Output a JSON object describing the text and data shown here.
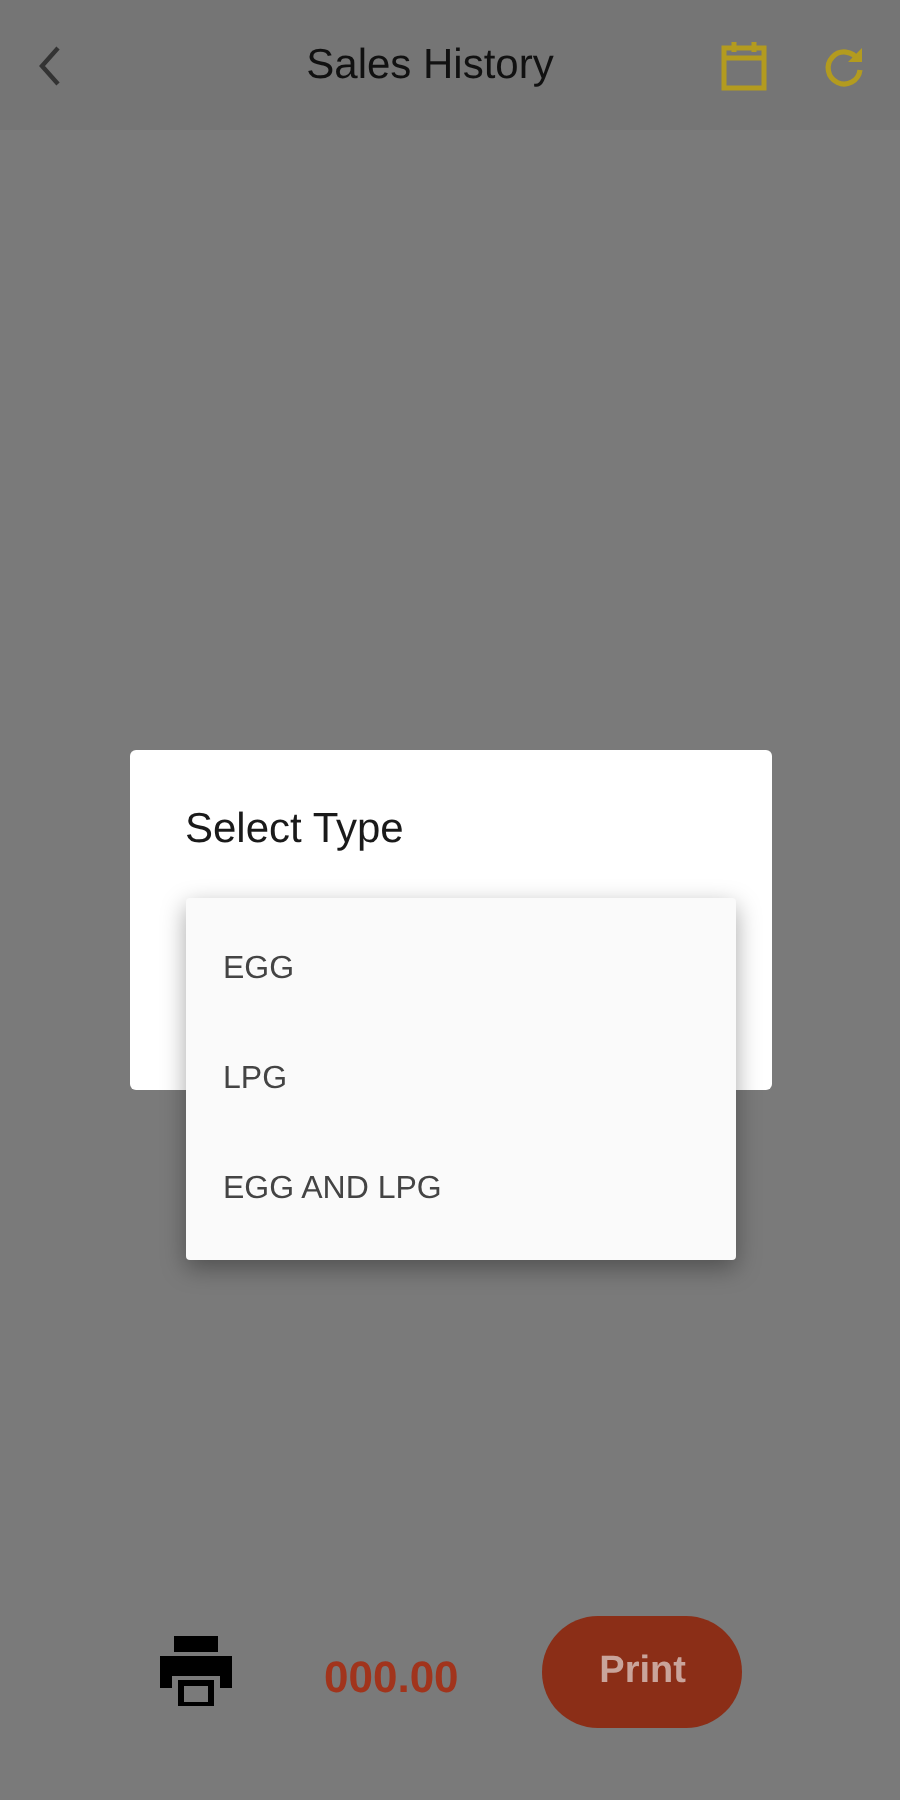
{
  "app_bar": {
    "title": "Sales History"
  },
  "dialog": {
    "title": "Select Type"
  },
  "menu": {
    "items": [
      {
        "label": "EGG"
      },
      {
        "label": "LPG"
      },
      {
        "label": "EGG AND LPG"
      }
    ]
  },
  "footer": {
    "amount": "000.00",
    "print_button": "Print"
  }
}
